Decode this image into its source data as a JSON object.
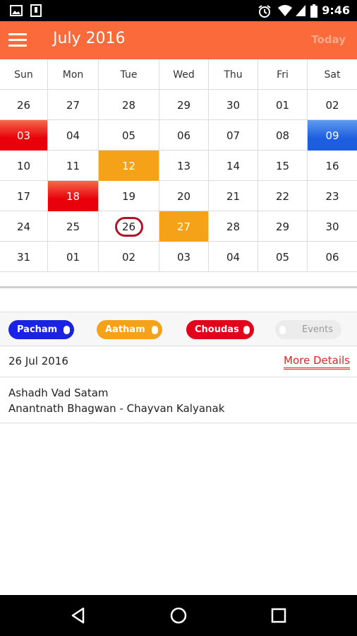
{
  "status_bar": {
    "time": "9:46",
    "icons": [
      "image-icon",
      "sim-card-icon",
      "alarm-icon",
      "wifi-icon",
      "signal-icon",
      "battery-icon"
    ]
  },
  "app_bar": {
    "title": "July 2016",
    "today_label": "Today",
    "accent_color": "#fa6a3a"
  },
  "calendar": {
    "weekdays": [
      "Sun",
      "Mon",
      "Tue",
      "Wed",
      "Thu",
      "Fri",
      "Sat"
    ],
    "weeks": [
      [
        "26",
        "27",
        "28",
        "29",
        "30",
        "01",
        "02"
      ],
      [
        "03",
        "04",
        "05",
        "06",
        "07",
        "08",
        "09"
      ],
      [
        "10",
        "11",
        "12",
        "13",
        "14",
        "15",
        "16"
      ],
      [
        "17",
        "18",
        "19",
        "20",
        "21",
        "22",
        "23"
      ],
      [
        "24",
        "25",
        "26",
        "27",
        "28",
        "29",
        "30"
      ],
      [
        "31",
        "01",
        "02",
        "03",
        "04",
        "05",
        "06"
      ]
    ],
    "highlights": {
      "1-0": "red",
      "1-6": "blue",
      "2-2": "orange",
      "3-1": "red",
      "4-3": "orange"
    },
    "selected": "4-2",
    "colors": {
      "red": "#e8000a",
      "orange": "#f5a218",
      "blue": "#1d5de0",
      "selected_ring": "#b0142a"
    }
  },
  "legend": {
    "toggles": [
      {
        "label": "Pacham",
        "color": "#1b23e3",
        "on": true
      },
      {
        "label": "Aatham",
        "color": "#f5a218",
        "on": true
      },
      {
        "label": "Choudas",
        "color": "#e3001b",
        "on": true
      },
      {
        "label": "Events",
        "color": "#ececec",
        "on": false
      }
    ]
  },
  "details": {
    "date": "26 Jul 2016",
    "more_label": "More Details",
    "lines": [
      "Ashadh Vad Satam",
      "Anantnath Bhagwan - Chayvan Kalyanak"
    ]
  }
}
